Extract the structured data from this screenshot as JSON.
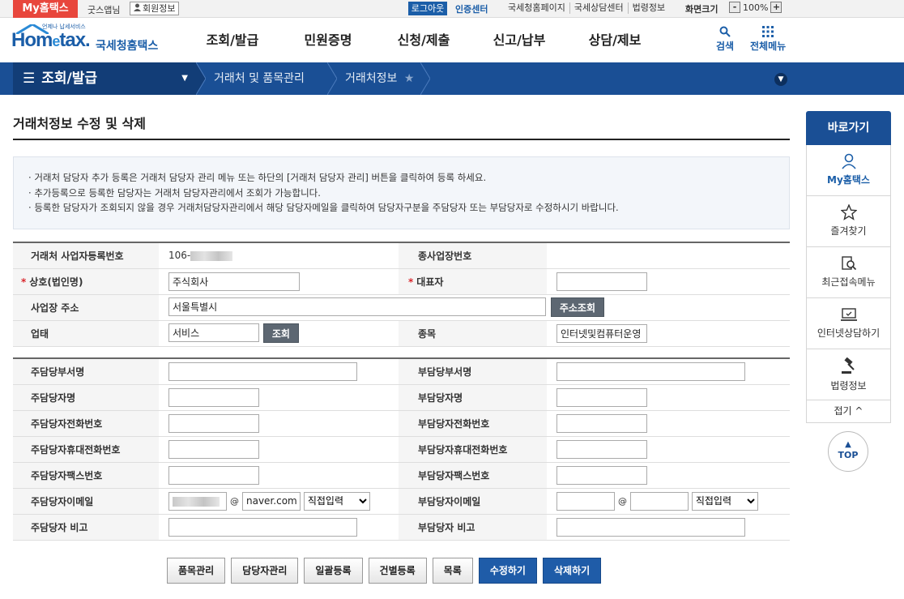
{
  "topbar": {
    "my_tab": "My홈택스",
    "user_name": "굿스앱님",
    "member_info": "회원정보",
    "logout": "로그아웃",
    "cert_center": "인증센터",
    "links": [
      "국세청홈페이지",
      "국세상담센터",
      "법령정보"
    ],
    "zoom_label": "화면크기",
    "zoom_value": "100%",
    "zoom_minus": "-",
    "zoom_plus": "+"
  },
  "header": {
    "logo_small": "언제나 납세서비스",
    "logo_home": "Hom",
    "logo_e": "e",
    "logo_tax": "tax.",
    "logo_kor": "국세청홈택스",
    "nav": [
      "조회/발급",
      "민원증명",
      "신청/제출",
      "신고/납부",
      "상담/제보"
    ],
    "search": "검색",
    "all_menu": "전체메뉴"
  },
  "menubar": {
    "section": "조회/발급",
    "crumbs": [
      "거래처 및 품목관리",
      "거래처정보"
    ]
  },
  "page": {
    "title": "거래처정보 수정 및 삭제",
    "notices": [
      "거래처 담당자 추가 등록은 거래처 담당자 관리 메뉴 또는 하단의 [거래처 담당자 관리] 버튼을 클릭하여 등록 하세요.",
      "추가등록으로 등록한 담당자는 거래처 담당자관리에서 조회가 가능합니다.",
      "등록한 담당자가 조회되지 않을 경우 거래처담당자관리에서 해당 담당자메일을 클릭하여 담당자구분을 주담당자 또는 부담당자로 수정하시기 바랍니다."
    ]
  },
  "form": {
    "biz_no_label": "거래처 사업자등록번호",
    "biz_no_value": "106-",
    "sub_biz_label": "종사업장번호",
    "company_label": "상호(법인명)",
    "company_value": "주식회사",
    "ceo_label": "대표자",
    "address_label": "사업장 주소",
    "address_value": "서울특별시",
    "address_btn": "주소조회",
    "biz_type_label": "업태",
    "biz_type_value": "서비스",
    "lookup_btn": "조회",
    "item_label": "종목",
    "item_value": "인터넷및컴퓨터운영"
  },
  "contacts": {
    "main_dept_label": "주담당부서명",
    "sub_dept_label": "부담당부서명",
    "main_name_label": "주담당자명",
    "sub_name_label": "부담당자명",
    "main_phone_label": "주담당자전화번호",
    "sub_phone_label": "부담당자전화번호",
    "main_mobile_label": "주담당자휴대전화번호",
    "sub_mobile_label": "부담당자휴대전화번호",
    "main_fax_label": "주담당자팩스번호",
    "sub_fax_label": "부담당자팩스번호",
    "main_email_label": "주담당자이메일",
    "sub_email_label": "부담당자이메일",
    "main_email_domain": "naver.com",
    "email_select": "직접입력",
    "at": "@",
    "main_note_label": "주담당자 비고",
    "sub_note_label": "부담당자 비고"
  },
  "buttons": {
    "items": "품목관리",
    "managers": "담당자관리",
    "bulk": "일괄등록",
    "single": "건별등록",
    "list": "목록",
    "edit": "수정하기",
    "delete": "삭제하기"
  },
  "quick": {
    "title": "바로가기",
    "my": "My홈택스",
    "favorites": "즐겨찾기",
    "recent": "최근접속메뉴",
    "consult": "인터넷상담하기",
    "law": "법령정보",
    "fold": "접기 ^",
    "top": "TOP"
  },
  "colors": {
    "brand_blue": "#1a4f95",
    "red": "#e8463c"
  }
}
